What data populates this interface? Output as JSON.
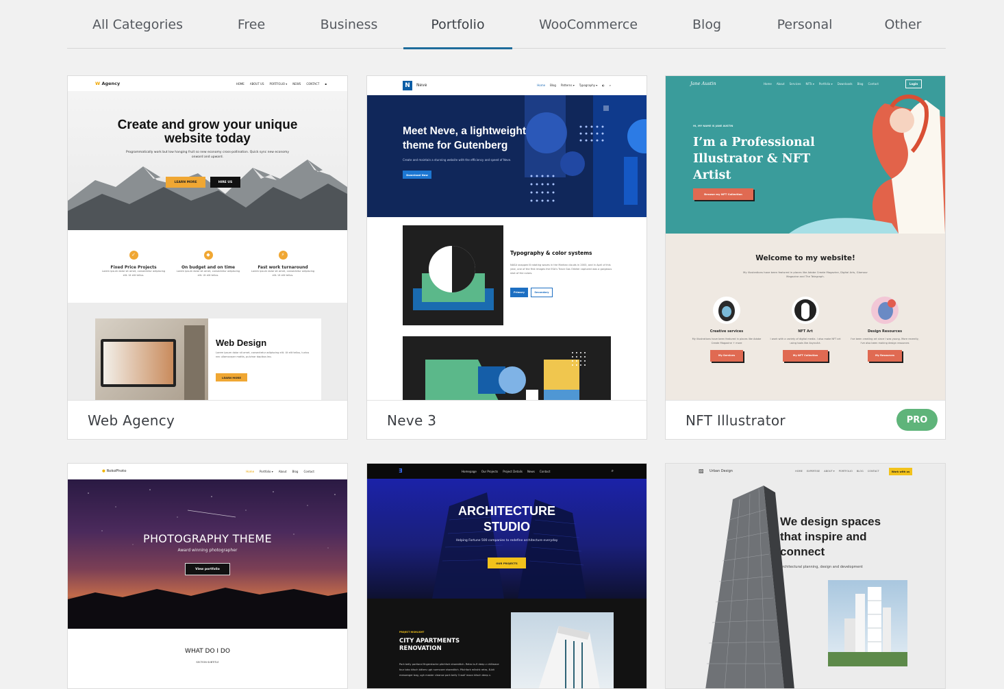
{
  "tabs": [
    {
      "label": "All Categories"
    },
    {
      "label": "Free"
    },
    {
      "label": "Business"
    },
    {
      "label": "Portfolio",
      "active": true
    },
    {
      "label": "WooCommerce"
    },
    {
      "label": "Blog"
    },
    {
      "label": "Personal"
    },
    {
      "label": "Other"
    }
  ],
  "colors": {
    "accent": "#1e6c9b",
    "pro_badge": "#5fb47a"
  },
  "cards": {
    "agency": {
      "name": "Web Agency",
      "brand": "Agency",
      "nav": [
        "HOME",
        "ABOUT US",
        "PORTFOLIO ▾",
        "NEWS",
        "CONTACT"
      ],
      "headline": "Create and grow your unique website today",
      "sub": "Programmatically work but low hanging fruit so new economy cross-pollination. Quick sync new economy onward and upward.",
      "btn1": "LEARN MORE",
      "btn2": "HIRE US",
      "features": [
        {
          "title": "Fixed Price Projects",
          "text": "Lorem ipsum dolor sit amet, consectetur adipiscing elit. Ut elit tellus."
        },
        {
          "title": "On budget and on time",
          "text": "Lorem ipsum dolor sit amet, consectetur adipiscing elit. Ut elit tellus."
        },
        {
          "title": "Fast work turnaround",
          "text": "Lorem ipsum dolor sit amet, consectetur adipiscing elit. Ut elit tellus."
        }
      ],
      "section_title": "Web Design",
      "section_text": "Lorem ipsum dolor sit amet, consectetur adipiscing elit. Ut elit tellus, luctus nec ullamcorper mattis, pulvinar dapibus leo.",
      "section_btn": "LEARN MORE"
    },
    "neve": {
      "name": "Neve 3",
      "brand": "Neve",
      "nav": [
        "Home",
        "Blog",
        "Patterns ▾",
        "Typography ▾"
      ],
      "headline": "Meet Neve, a lightweight theme for Gutenberg",
      "sub": "Create and maintain a stunning website with the efficiency and speed of Neve.",
      "btn": "Download Now",
      "section_title": "Typography & color systems",
      "section_text": "NASA snapped 8 rotating waves in the Martian clouds in 2003, and in April of this year, one of the first images the ESA's Trace Gas Orbiter captured was a gorgeous shot of the colors.",
      "btn_primary": "Primary",
      "btn_secondary": "Secondary"
    },
    "nft": {
      "name": "NFT Illustrator",
      "badge": "PRO",
      "brand": "Jane Austin",
      "nav": [
        "Home",
        "About",
        "Services",
        "NFTs ▾",
        "Portfolio ▾",
        "Downloads",
        "Blog",
        "Contact"
      ],
      "login": "Login",
      "eyebrow": "HI, MY NAME IS JANE AUSTIN",
      "headline": "I’m a Professional Illustrator & NFT Artist",
      "btn": "Browse my NFT Collection",
      "welcome": "Welcome to my website!",
      "welcome_text": "My illustrations have been featured in places like Adobe Create Magazine, Digital Arts, Glamour Magazine and The Telegraph.",
      "services": [
        {
          "title": "Creative services",
          "text": "My illustrations have been featured in places like Adobe Create Magazine + more",
          "btn": "My Services"
        },
        {
          "title": "NFT Art",
          "text": "I work with a variety of digital media. I also make NFT art using tools like AsyncArt.",
          "btn": "My NFT Collection"
        },
        {
          "title": "Design Resources",
          "text": "I've been creating art since I was young. More recently, I've also been making design resources",
          "btn": "My Resources"
        }
      ]
    },
    "photo": {
      "brand": "RokoPhoto",
      "nav": [
        "Home",
        "Portfolio ▾",
        "About",
        "Blog",
        "Contact"
      ],
      "headline": "PHOTOGRAPHY THEME",
      "sub": "Award winning photographer",
      "btn": "View portfolio",
      "section_title": "WHAT DO I DO",
      "section_sub": "SECTION SUBTITLE"
    },
    "arch": {
      "nav": [
        "Homepage",
        "Our Projects",
        "Project Details",
        "News",
        "Contact"
      ],
      "headline": "ARCHITECTURE STUDIO",
      "sub": "Helping Fortune 500 companies to redefine architecture everyday",
      "btn": "OUR PROJECTS",
      "eyebrow": "PROJECT HIGHLIGHT",
      "project_title": "CITY APARTMENTS RENOVATION",
      "project_text": "Pork belly portland fingerstache pitchfork shoreditch. Retro lo-fi deep v chillwave four loko kitsch bitters ugh normcore shoreditch. Pitchfork mlkshk retro, 8-bit messenger bag, ugh master cleanse pork belly 3 wolf moon kitsch deep v."
    },
    "urban": {
      "brand": "Urban Design",
      "nav": [
        "HOME",
        "EXPERTISE",
        "ABOUT ▾",
        "PORTFOLIO",
        "BLOG",
        "CONTACT"
      ],
      "cta": "Work with us",
      "headline": "We design spaces that inspire and connect",
      "sub": "Architectural planning, design and development"
    }
  }
}
